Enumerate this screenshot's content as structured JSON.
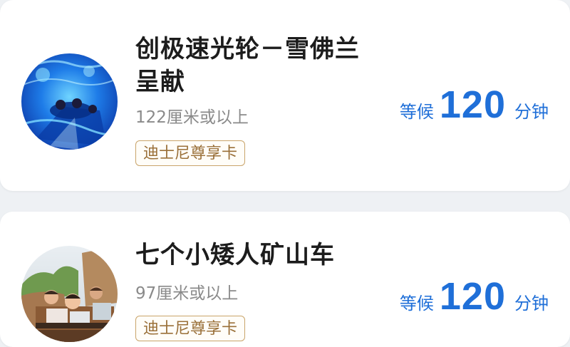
{
  "attractions": [
    {
      "name": "创极速光轮－雪佛兰呈献",
      "height_requirement": "122厘米或以上",
      "badge": "迪士尼尊享卡",
      "wait_label": "等候",
      "wait_value": "120",
      "wait_unit": "分钟",
      "thumbnail_icon": "tron-ride-photo-icon"
    },
    {
      "name": "七个小矮人矿山车",
      "height_requirement": "97厘米或以上",
      "badge": "迪士尼尊享卡",
      "wait_label": "等候",
      "wait_value": "120",
      "wait_unit": "分钟",
      "thumbnail_icon": "mine-train-ride-photo-icon"
    }
  ],
  "colors": {
    "accent_blue": "#1f6fd8",
    "badge_gold": "#9a7039",
    "title_text": "#1c1c1c",
    "secondary_text": "#8a8a8a"
  }
}
